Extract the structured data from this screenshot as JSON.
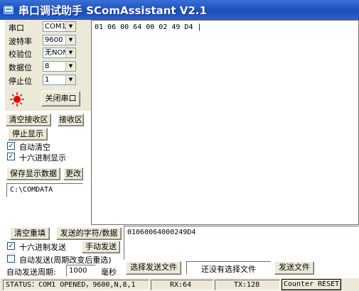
{
  "window": {
    "title": "串口调试助手 SComAssistant V2.1"
  },
  "settings": {
    "port_label": "串口",
    "port_value": "COM1",
    "baud_label": "波特率",
    "baud_value": "9600",
    "parity_label": "校验位",
    "parity_value": "无NON",
    "databits_label": "数据位",
    "databits_value": "8",
    "stopbits_label": "停止位",
    "stopbits_value": "1",
    "close_port_label": "关闭串口",
    "indicator_color": "#e00000"
  },
  "receive": {
    "clear_label": "清空接收区",
    "area_label": "接收区",
    "stop_display_label": "停止显示",
    "auto_clear_label": "自动清空",
    "hex_display_label": "十六进制显示",
    "save_label": "保存显示数据",
    "change_label": "更改",
    "save_path": "C:\\COMDATA",
    "content": "01 06 00 64 00 02 49 D4 |"
  },
  "send": {
    "clear_label": "清空重填",
    "area_label": "发送的字符/数据",
    "hex_send_label": "十六进制发送",
    "manual_send_label": "手动发送",
    "auto_send_label": "自动发送(周期改变后重选)",
    "period_label": "自动发送周期:",
    "period_value": "1000",
    "period_unit": "毫秒",
    "content": "01060064000249D4",
    "select_file_label": "选择发送文件",
    "file_status": "还没有选择文件",
    "send_file_label": "发送文件"
  },
  "status": {
    "port_status": "STATUS：COM1 OPENED，9600,N,8,1",
    "rx": "RX:64",
    "tx": "TX:128",
    "counter_reset_label": "Counter RESET"
  }
}
